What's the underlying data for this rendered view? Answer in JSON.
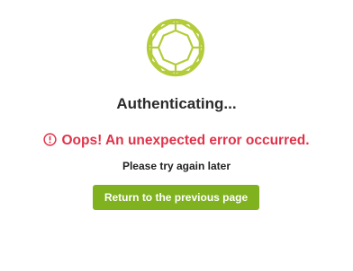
{
  "logo": {
    "icon": "geodesic-diamond-logo",
    "color": "#b5cc3a"
  },
  "status": {
    "title": "Authenticating..."
  },
  "error": {
    "icon": "alert-circle-icon",
    "message": "Oops! An unexpected error occurred.",
    "color": "#e0334a"
  },
  "subtitle": "Please try again later",
  "return_button": {
    "label": "Return to the previous page",
    "color": "#7fb21e"
  }
}
